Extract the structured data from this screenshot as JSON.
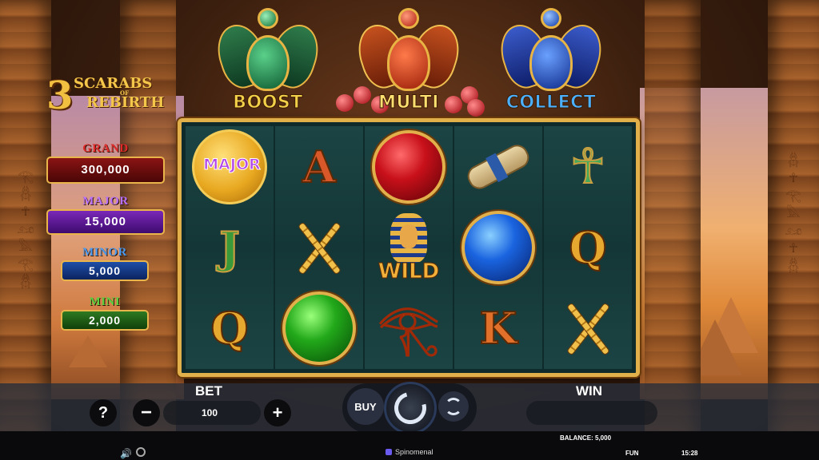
{
  "game": {
    "logo": {
      "number": "3",
      "line1": "SCARABS",
      "of": "OF",
      "line2": "REBIRTH"
    },
    "features": [
      {
        "name": "BOOST",
        "color": "#2e7a4a"
      },
      {
        "name": "MULTI",
        "color": "#c4501e"
      },
      {
        "name": "COLLECT",
        "color": "#3a5ac8"
      }
    ]
  },
  "jackpots": {
    "grand": {
      "label": "GRAND",
      "value": "300,000",
      "color": "#e02a2a"
    },
    "major": {
      "label": "MAJOR",
      "value": "15,000",
      "color": "#b870ff"
    },
    "minor": {
      "label": "MINOR",
      "value": "5,000",
      "color": "#4a9af0"
    },
    "mini": {
      "label": "MINI",
      "value": "2,000",
      "color": "#5ad040"
    }
  },
  "reels": [
    [
      "coin-major",
      "letter-J",
      "letter-Q"
    ],
    [
      "letter-A",
      "crook-flail",
      "orb-green"
    ],
    [
      "orb-red",
      "pharaoh-wild",
      "eye-of-horus"
    ],
    [
      "scroll",
      "orb-blue",
      "letter-K"
    ],
    [
      "ankh",
      "letter-Q",
      "crook-flail"
    ]
  ],
  "symbols": {
    "coin_label": "MAJOR",
    "wild_label": "WILD",
    "letter_A": "A",
    "letter_J": "J",
    "letter_Q": "Q",
    "letter_K": "K",
    "ankh_glyph": "☥",
    "eye_glyph": "𓂀"
  },
  "controls": {
    "help": "?",
    "bet_label": "BET",
    "bet_value": "100",
    "minus": "−",
    "plus": "+",
    "buy": "BUY",
    "win_label": "WIN",
    "win_value": ""
  },
  "status": {
    "balance": "BALANCE: 5,000",
    "brand": "Spinomenal",
    "mode": "FUN",
    "time": "15:28"
  }
}
